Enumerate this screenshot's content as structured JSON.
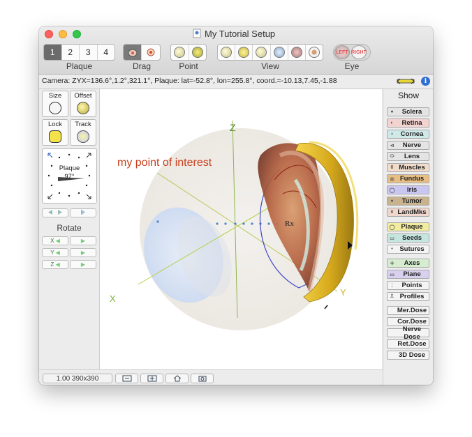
{
  "window": {
    "title": "My Tutorial Setup"
  },
  "toolbar": {
    "plaque_label": "Plaque",
    "plaque_tabs": [
      "1",
      "2",
      "3",
      "4"
    ],
    "drag_label": "Drag",
    "point_label": "Point",
    "view_label": "View",
    "eye_label": "Eye",
    "eye_left": "LEFT",
    "eye_right": "RIGHT"
  },
  "status": {
    "text": "Camera: ZYX=136.6°,1.2°,321.1°, Plaque: lat=-52.8°, lon=255.8°, coord.=-10.13,7.45,-1.88",
    "info": "i"
  },
  "left_panel": {
    "size_label": "Size",
    "offset_label": "Offset",
    "lock_label": "Lock",
    "track_label": "Track",
    "dial_label": "Plaque",
    "dial_value": "97°",
    "rotate_label": "Rotate",
    "x_label": "X",
    "y_label": "Y",
    "z_label": "Z"
  },
  "canvas": {
    "annotation": "my point of interest",
    "rx_label": "Rx"
  },
  "right_panel": {
    "show_label": "Show",
    "buttons": [
      {
        "label": "Sclera",
        "color": "#e4e4e4",
        "icon": "●"
      },
      {
        "label": "Retina",
        "color": "#f3d3cf",
        "icon": "◐"
      },
      {
        "label": "Cornea",
        "color": "#cfe8e8",
        "icon": "◗"
      },
      {
        "label": "Nerve",
        "color": "#e4e4e4",
        "icon": "⊲"
      },
      {
        "label": "Lens",
        "color": "#e4e4e4",
        "icon": "⬭"
      },
      {
        "label": "Muscles",
        "color": "#f1dccc",
        "icon": "0"
      },
      {
        "label": "Fundus",
        "color": "#e7bf85",
        "icon": "◎"
      },
      {
        "label": "Iris",
        "color": "#cac6f2",
        "icon": "◯"
      },
      {
        "label": "Tumor",
        "color": "#c9b38e",
        "icon": "●"
      },
      {
        "label": "LandMks",
        "color": "#efd7cd",
        "icon": "¤"
      },
      {
        "label": "Plaque",
        "color": "#f1ec9f",
        "icon": "◯"
      },
      {
        "label": "Seeds",
        "color": "#c5e6df",
        "icon": "▭"
      },
      {
        "label": "Sutures",
        "color": "#f4f4f4",
        "icon": "•"
      },
      {
        "label": "Axes",
        "color": "#d6edd0",
        "icon": "✛"
      },
      {
        "label": "Plane",
        "color": "#d8d0ee",
        "icon": "▭"
      },
      {
        "label": "Points",
        "color": "#f4f4f4",
        "icon": "⁚"
      },
      {
        "label": "Profiles",
        "color": "#f4f4f4",
        "icon": "⎍"
      },
      {
        "label": "Mer.Dose",
        "color": "#f4f4f4",
        "icon": ""
      },
      {
        "label": "Cor.Dose",
        "color": "#f4f4f4",
        "icon": ""
      },
      {
        "label": "Nerve Dose",
        "color": "#f4f4f4",
        "icon": ""
      },
      {
        "label": "Ret.Dose",
        "color": "#f4f4f4",
        "icon": ""
      },
      {
        "label": "3D Dose",
        "color": "#f4f4f4",
        "icon": ""
      }
    ]
  },
  "bottom": {
    "zoom_text": "1.00 390x390"
  }
}
